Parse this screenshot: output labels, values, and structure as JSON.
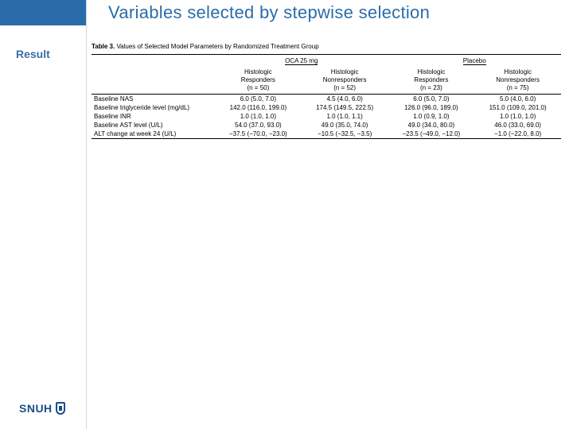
{
  "title": "Variables selected by stepwise selection",
  "sidebar": {
    "result_label": "Result"
  },
  "logo": {
    "text": "SNUH"
  },
  "table": {
    "caption_bold": "Table 3.",
    "caption_rest": "Values of Selected Model Parameters by Randomized Treatment Group",
    "group_headers": [
      "OCA 25 mg",
      "Placebo"
    ],
    "sub_headers": [
      {
        "line1": "Histologic",
        "line2": "Responders",
        "n": "(n = 50)"
      },
      {
        "line1": "Histologic",
        "line2": "Nonresponders",
        "n": "(n = 52)"
      },
      {
        "line1": "Histologic",
        "line2": "Responders",
        "n": "(n = 23)"
      },
      {
        "line1": "Histologic",
        "line2": "Nonresponders",
        "n": "(n = 75)"
      }
    ],
    "rows": [
      {
        "label": "Baseline NAS",
        "cells": [
          "6.0 (5.0, 7.0)",
          "4.5 (4.0, 6.0)",
          "6.0 (5.0, 7.0)",
          "5.0 (4.0, 6.0)"
        ]
      },
      {
        "label": "Baseline triglyceride level (mg/dL)",
        "cells": [
          "142.0 (116.0, 199.0)",
          "174.5 (149.5, 222.5)",
          "126.0 (96.0, 189.0)",
          "151.0 (109.0, 201.0)"
        ]
      },
      {
        "label": "Baseline INR",
        "cells": [
          "1.0 (1.0, 1.0)",
          "1.0 (1.0, 1.1)",
          "1.0 (0.9, 1.0)",
          "1.0 (1.0, 1.0)"
        ]
      },
      {
        "label": "Baseline AST level (U/L)",
        "cells": [
          "54.0 (37.0, 93.0)",
          "49.0 (35.0, 74.0)",
          "49.0 (34.0, 80.0)",
          "46.0 (33.0, 69.0)"
        ]
      },
      {
        "label": "ALT change at week 24 (U/L)",
        "cells": [
          "−37.5 (−70.0, −23.0)",
          "−10.5 (−32.5, −3.5)",
          "−23.5 (−49.0, −12.0)",
          "−1.0 (−22.0, 8.0)"
        ]
      }
    ]
  }
}
